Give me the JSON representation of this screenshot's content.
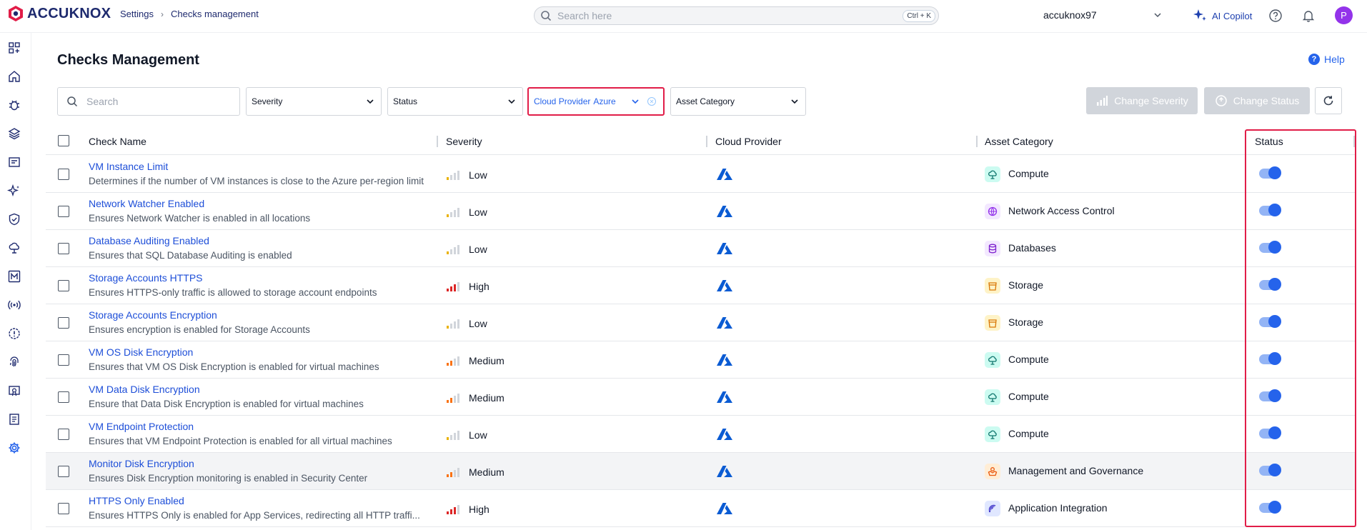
{
  "app": {
    "logo_text": "ACCUKNOX"
  },
  "breadcrumb": {
    "parent": "Settings",
    "current": "Checks management"
  },
  "global_search": {
    "placeholder": "Search here",
    "shortcut": "Ctrl + K"
  },
  "account": {
    "name": "accuknox97"
  },
  "copilot": {
    "label": "AI Copilot"
  },
  "avatar": {
    "initial": "P"
  },
  "page": {
    "title": "Checks Management",
    "help": "Help"
  },
  "filters": {
    "search_placeholder": "Search",
    "severity": "Severity",
    "status": "Status",
    "cloud_provider_label": "Cloud Provider",
    "cloud_provider_value": "Azure",
    "asset_category": "Asset Category"
  },
  "actions": {
    "change_severity": "Change Severity",
    "change_status": "Change Status"
  },
  "table": {
    "headers": {
      "check_name": "Check Name",
      "severity": "Severity",
      "cloud_provider": "Cloud Provider",
      "asset_category": "Asset Category",
      "status": "Status"
    },
    "rows": [
      {
        "name": "VM Instance Limit",
        "desc": "Determines if the number of VM instances is close to the Azure per-region limit",
        "severity": "Low",
        "asset": "Compute",
        "asset_icon": "compute-icon",
        "enabled": true
      },
      {
        "name": "Network Watcher Enabled",
        "desc": "Ensures Network Watcher is enabled in all locations",
        "severity": "Low",
        "asset": "Network Access Control",
        "asset_icon": "network-access-icon",
        "enabled": true
      },
      {
        "name": "Database Auditing Enabled",
        "desc": "Ensures that SQL Database Auditing is enabled",
        "severity": "Low",
        "asset": "Databases",
        "asset_icon": "database-icon",
        "enabled": true
      },
      {
        "name": "Storage Accounts HTTPS",
        "desc": "Ensures HTTPS-only traffic is allowed to storage account endpoints",
        "severity": "High",
        "asset": "Storage",
        "asset_icon": "storage-icon",
        "enabled": true
      },
      {
        "name": "Storage Accounts Encryption",
        "desc": "Ensures encryption is enabled for Storage Accounts",
        "severity": "Low",
        "asset": "Storage",
        "asset_icon": "storage-icon",
        "enabled": true
      },
      {
        "name": "VM OS Disk Encryption",
        "desc": "Ensures that VM OS Disk Encryption is enabled for virtual machines",
        "severity": "Medium",
        "asset": "Compute",
        "asset_icon": "compute-icon",
        "enabled": true
      },
      {
        "name": "VM Data Disk Encryption",
        "desc": "Ensure that Data Disk Encryption is enabled for virtual machines",
        "severity": "Medium",
        "asset": "Compute",
        "asset_icon": "compute-icon",
        "enabled": true
      },
      {
        "name": "VM Endpoint Protection",
        "desc": "Ensures that VM Endpoint Protection is enabled for all virtual machines",
        "severity": "Low",
        "asset": "Compute",
        "asset_icon": "compute-icon",
        "enabled": true
      },
      {
        "name": "Monitor Disk Encryption",
        "desc": "Ensures Disk Encryption monitoring is enabled in Security Center",
        "severity": "Medium",
        "asset": "Management and Governance",
        "asset_icon": "management-governance-icon",
        "enabled": true
      },
      {
        "name": "HTTPS Only Enabled",
        "desc": "Ensures HTTPS Only is enabled for App Services, redirecting all HTTP traffi...",
        "severity": "High",
        "asset": "Application Integration",
        "asset_icon": "application-integration-icon",
        "enabled": true
      }
    ]
  },
  "colors": {
    "brand": "#1e2a6e",
    "link": "#1d4ed8",
    "highlight_border": "#e11d48",
    "toggle_on": "#2563eb",
    "severity_low": "#eab308",
    "severity_medium": "#f97316",
    "severity_high": "#dc2626"
  }
}
